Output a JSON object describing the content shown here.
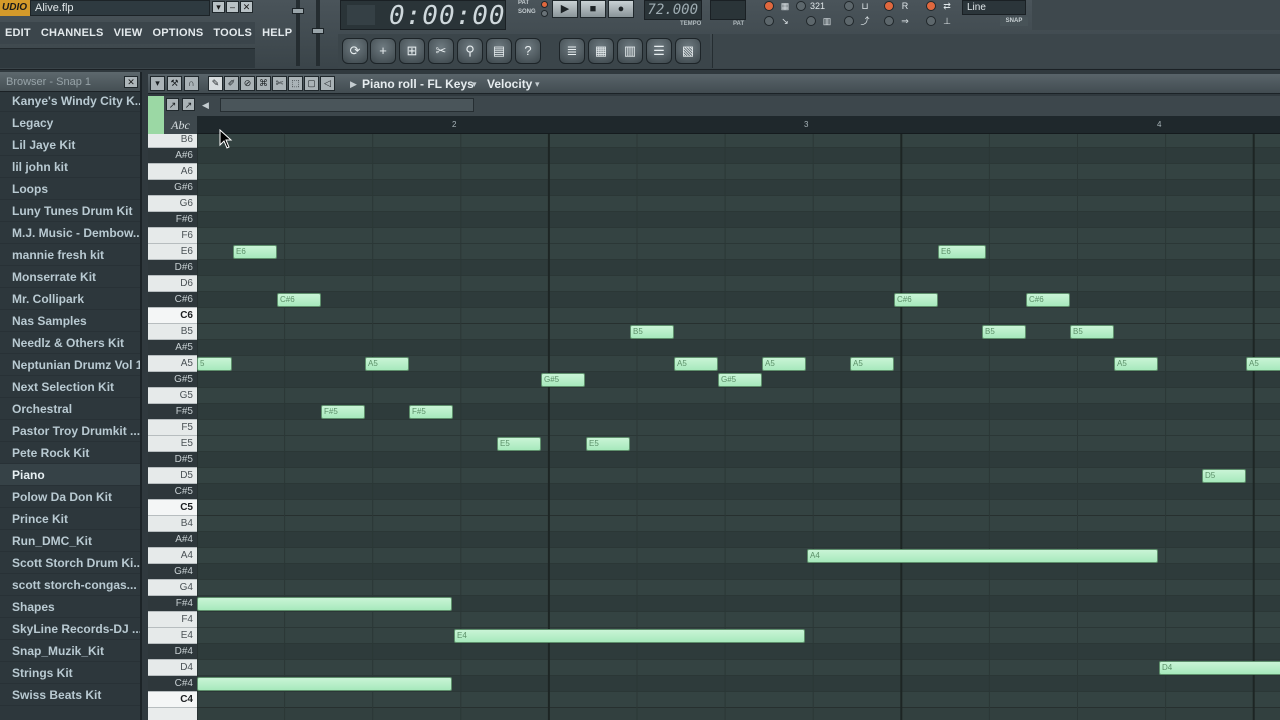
{
  "window": {
    "logo": "UDIO",
    "title": "Alive.flp"
  },
  "menu": [
    "EDIT",
    "CHANNELS",
    "VIEW",
    "OPTIONS",
    "TOOLS",
    "HELP"
  ],
  "transport": {
    "time": "0:00:00",
    "pat_label": "PAT",
    "song_label": "SONG",
    "play_icon": "▶",
    "stop_icon": "■",
    "record_icon": "●",
    "tempo": "72.000",
    "tempo_label": "TEMPO",
    "pattern_label": "PAT"
  },
  "snap": {
    "value": "Line",
    "label": "SNAP"
  },
  "browser": {
    "title": "Browser - Snap 1",
    "items": [
      "Kanye's Windy City K...",
      "Legacy",
      "Lil Jaye Kit",
      "lil john kit",
      "Loops",
      "Luny Tunes Drum Kit",
      "M.J. Music - Dembow...",
      "mannie fresh kit",
      "Monserrate Kit",
      "Mr. Collipark",
      "Nas Samples",
      "Needlz & Others Kit",
      "Neptunian Drumz Vol 1",
      "Next Selection Kit",
      "Orchestral",
      "Pastor Troy Drumkit ...",
      "Pete Rock Kit",
      "Piano",
      "Polow Da Don Kit",
      "Prince Kit",
      "Run_DMC_Kit",
      "Scott Storch Drum Ki...",
      "scott storch-congas...",
      "Shapes",
      "SkyLine Records-DJ ...",
      "Snap_Muzik_Kit",
      "Strings Kit",
      "Swiss Beats Kit"
    ],
    "selected": "Piano"
  },
  "piano_roll": {
    "title": "Piano roll - FL Keys",
    "target": "Velocity",
    "abc_label": "Abc",
    "bars": [
      "2",
      "3",
      "4"
    ],
    "keys": [
      "B6",
      "A#6",
      "A6",
      "G#6",
      "G6",
      "F#6",
      "F6",
      "E6",
      "D#6",
      "D6",
      "C#6",
      "C6",
      "B5",
      "A#5",
      "A5",
      "G#5",
      "G5",
      "F#5",
      "F5",
      "E5",
      "D#5",
      "D5",
      "C#5",
      "C5",
      "B4",
      "A#4",
      "A4",
      "G#4",
      "G4",
      "F#4",
      "F4",
      "E4",
      "D#4",
      "D4",
      "C#4",
      "C4"
    ],
    "notes": [
      {
        "pitch": "A5",
        "label": "5",
        "start": 0.0,
        "len": 0.4
      },
      {
        "pitch": "F#4",
        "label": "",
        "start": 0.0,
        "len": 2.9
      },
      {
        "pitch": "C#4",
        "label": "",
        "start": 0.0,
        "len": 2.9
      },
      {
        "pitch": "E6",
        "label": "E6",
        "start": 0.41,
        "len": 0.5
      },
      {
        "pitch": "C#6",
        "label": "C#6",
        "start": 0.91,
        "len": 0.5
      },
      {
        "pitch": "F#5",
        "label": "F#5",
        "start": 1.41,
        "len": 0.5
      },
      {
        "pitch": "A5",
        "label": "A5",
        "start": 1.91,
        "len": 0.5
      },
      {
        "pitch": "F#5",
        "label": "F#5",
        "start": 2.41,
        "len": 0.5
      },
      {
        "pitch": "E5",
        "label": "E5",
        "start": 3.41,
        "len": 0.5
      },
      {
        "pitch": "G#5",
        "label": "G#5",
        "start": 3.91,
        "len": 0.5
      },
      {
        "pitch": "E5",
        "label": "E5",
        "start": 4.41,
        "len": 0.5
      },
      {
        "pitch": "B5",
        "label": "B5",
        "start": 4.91,
        "len": 0.5
      },
      {
        "pitch": "A5",
        "label": "A5",
        "start": 5.41,
        "len": 0.5
      },
      {
        "pitch": "G#5",
        "label": "G#5",
        "start": 5.91,
        "len": 0.5
      },
      {
        "pitch": "A5",
        "label": "A5",
        "start": 6.41,
        "len": 0.5
      },
      {
        "pitch": "E4",
        "label": "E4",
        "start": 2.92,
        "len": 3.98
      },
      {
        "pitch": "A4",
        "label": "A4",
        "start": 6.92,
        "len": 3.98
      },
      {
        "pitch": "A5",
        "label": "A5",
        "start": 7.41,
        "len": 0.5
      },
      {
        "pitch": "C#6",
        "label": "C#6",
        "start": 7.91,
        "len": 0.5
      },
      {
        "pitch": "E6",
        "label": "E6",
        "start": 8.41,
        "len": 0.55
      },
      {
        "pitch": "B5",
        "label": "B5",
        "start": 8.91,
        "len": 0.5
      },
      {
        "pitch": "C#6",
        "label": "C#6",
        "start": 9.41,
        "len": 0.5
      },
      {
        "pitch": "B5",
        "label": "B5",
        "start": 9.91,
        "len": 0.5
      },
      {
        "pitch": "A5",
        "label": "A5",
        "start": 10.41,
        "len": 0.5
      },
      {
        "pitch": "D5",
        "label": "D5",
        "start": 11.41,
        "len": 0.5
      },
      {
        "pitch": "A5",
        "label": "A5",
        "start": 11.91,
        "len": 0.5
      },
      {
        "pitch": "D4",
        "label": "D4",
        "start": 10.92,
        "len": 2.0
      }
    ]
  },
  "colors": {
    "note_fill": "#b5eec7",
    "grid_bg": "#32403f",
    "accent_orange": "#e0683e"
  }
}
